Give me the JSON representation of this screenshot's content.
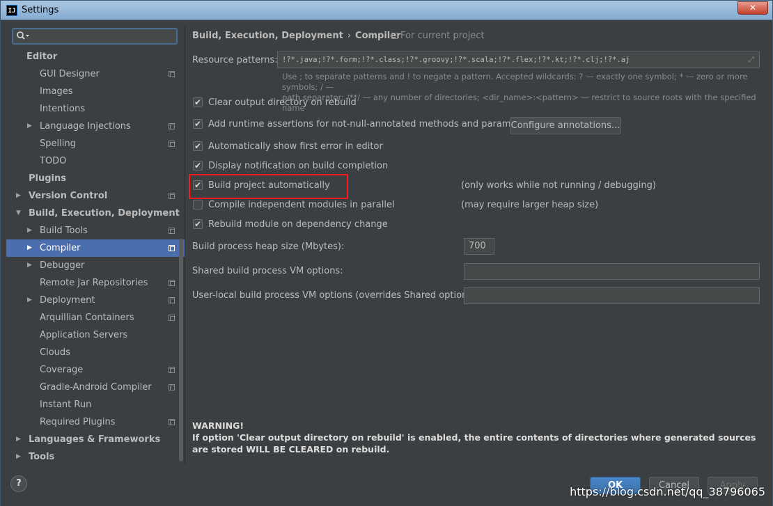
{
  "window": {
    "title": "Settings",
    "app_icon": "IJ",
    "close": "✕"
  },
  "search": {
    "icon": "search-icon",
    "placeholder": ""
  },
  "sidebar": {
    "items": [
      {
        "label": "Editor",
        "level": 0,
        "bold": true,
        "arrow": "",
        "copy": false
      },
      {
        "label": "GUI Designer",
        "level": 1,
        "bold": false,
        "arrow": "",
        "copy": true
      },
      {
        "label": "Images",
        "level": 1,
        "bold": false,
        "arrow": "",
        "copy": false
      },
      {
        "label": "Intentions",
        "level": 1,
        "bold": false,
        "arrow": "",
        "copy": false
      },
      {
        "label": "Language Injections",
        "level": 1,
        "bold": false,
        "arrow": "▶",
        "copy": true
      },
      {
        "label": "Spelling",
        "level": 1,
        "bold": false,
        "arrow": "",
        "copy": true
      },
      {
        "label": "TODO",
        "level": 1,
        "bold": false,
        "arrow": "",
        "copy": false
      },
      {
        "label": "Plugins",
        "level": 0,
        "bold": true,
        "arrow": "",
        "copy": false
      },
      {
        "label": "Version Control",
        "level": 0,
        "bold": true,
        "arrow": "▶",
        "copy": true
      },
      {
        "label": "Build, Execution, Deployment",
        "level": 0,
        "bold": true,
        "arrow": "▼",
        "copy": false
      },
      {
        "label": "Build Tools",
        "level": 1,
        "bold": false,
        "arrow": "▶",
        "copy": true
      },
      {
        "label": "Compiler",
        "level": 1,
        "bold": false,
        "arrow": "▶",
        "copy": true,
        "selected": true
      },
      {
        "label": "Debugger",
        "level": 1,
        "bold": false,
        "arrow": "▶",
        "copy": false
      },
      {
        "label": "Remote Jar Repositories",
        "level": 1,
        "bold": false,
        "arrow": "",
        "copy": true
      },
      {
        "label": "Deployment",
        "level": 1,
        "bold": false,
        "arrow": "▶",
        "copy": true
      },
      {
        "label": "Arquillian Containers",
        "level": 1,
        "bold": false,
        "arrow": "",
        "copy": true
      },
      {
        "label": "Application Servers",
        "level": 1,
        "bold": false,
        "arrow": "",
        "copy": false
      },
      {
        "label": "Clouds",
        "level": 1,
        "bold": false,
        "arrow": "",
        "copy": false
      },
      {
        "label": "Coverage",
        "level": 1,
        "bold": false,
        "arrow": "",
        "copy": true
      },
      {
        "label": "Gradle-Android Compiler",
        "level": 1,
        "bold": false,
        "arrow": "",
        "copy": true
      },
      {
        "label": "Instant Run",
        "level": 1,
        "bold": false,
        "arrow": "",
        "copy": false
      },
      {
        "label": "Required Plugins",
        "level": 1,
        "bold": false,
        "arrow": "",
        "copy": true
      },
      {
        "label": "Languages & Frameworks",
        "level": 0,
        "bold": true,
        "arrow": "▶",
        "copy": false
      },
      {
        "label": "Tools",
        "level": 0,
        "bold": true,
        "arrow": "▶",
        "copy": false
      }
    ]
  },
  "breadcrumb": {
    "parent": "Build, Execution, Deployment",
    "separator": "›",
    "current": "Compiler"
  },
  "scope": {
    "label": "For current project"
  },
  "resource_patterns": {
    "label": "Resource patterns:",
    "value": "!?*.java;!?*.form;!?*.class;!?*.groovy;!?*.scala;!?*.flex;!?*.kt;!?*.clj;!?*.aj",
    "hint_1": "Use ; to separate patterns and ! to negate a pattern. Accepted wildcards: ? — exactly one symbol; * — zero or more symbols; / —",
    "hint_2": "path separator; /**/ — any number of directories; <dir_name>:<pattern> — restrict to source roots with the specified name"
  },
  "options": {
    "clear_output": {
      "label": "Clear output directory on rebuild",
      "checked": true
    },
    "runtime_assertions": {
      "label": "Add runtime assertions for not-null-annotated methods and parameters",
      "checked": true
    },
    "configure_annotations": "Configure annotations...",
    "show_first_error": {
      "label": "Automatically show first error in editor",
      "checked": true
    },
    "notify_build": {
      "label": "Display notification on build completion",
      "checked": true
    },
    "build_auto": {
      "label": "Build project automatically",
      "checked": true,
      "note": "(only works while not running / debugging)"
    },
    "compile_parallel": {
      "label": "Compile independent modules in parallel",
      "checked": false,
      "note": "(may require larger heap size)"
    },
    "rebuild_dependency": {
      "label": "Rebuild module on dependency change",
      "checked": true
    }
  },
  "heap": {
    "label": "Build process heap size (Mbytes):",
    "value": "700"
  },
  "shared_vm": {
    "label": "Shared build process VM options:",
    "value": ""
  },
  "local_vm": {
    "label": "User-local build process VM options (overrides Shared options):",
    "value": ""
  },
  "warning": {
    "title": "WARNING!",
    "text": "If option 'Clear output directory on rebuild' is enabled, the entire contents of directories where generated sources are stored WILL BE CLEARED on rebuild."
  },
  "footer": {
    "help": "?",
    "ok": "OK",
    "cancel": "Cancel",
    "apply": "Apply"
  },
  "watermark": "https://blog.csdn.net/qq_38796065"
}
